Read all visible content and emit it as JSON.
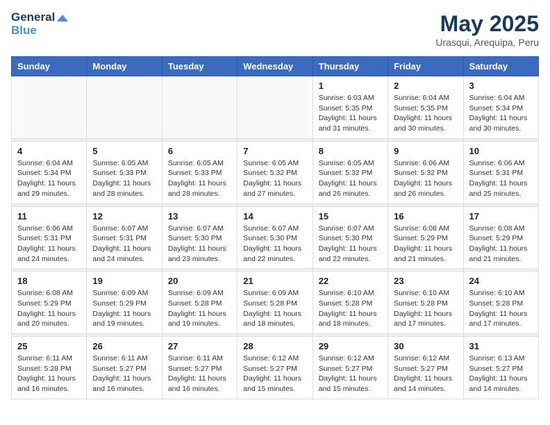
{
  "header": {
    "logo_line1": "General",
    "logo_line2": "Blue",
    "month": "May 2025",
    "location": "Urasqui, Arequipa, Peru"
  },
  "weekdays": [
    "Sunday",
    "Monday",
    "Tuesday",
    "Wednesday",
    "Thursday",
    "Friday",
    "Saturday"
  ],
  "weeks": [
    [
      {
        "day": "",
        "info": ""
      },
      {
        "day": "",
        "info": ""
      },
      {
        "day": "",
        "info": ""
      },
      {
        "day": "",
        "info": ""
      },
      {
        "day": "1",
        "info": "Sunrise: 6:03 AM\nSunset: 5:35 PM\nDaylight: 11 hours\nand 31 minutes."
      },
      {
        "day": "2",
        "info": "Sunrise: 6:04 AM\nSunset: 5:35 PM\nDaylight: 11 hours\nand 30 minutes."
      },
      {
        "day": "3",
        "info": "Sunrise: 6:04 AM\nSunset: 5:34 PM\nDaylight: 11 hours\nand 30 minutes."
      }
    ],
    [
      {
        "day": "4",
        "info": "Sunrise: 6:04 AM\nSunset: 5:34 PM\nDaylight: 11 hours\nand 29 minutes."
      },
      {
        "day": "5",
        "info": "Sunrise: 6:05 AM\nSunset: 5:33 PM\nDaylight: 11 hours\nand 28 minutes."
      },
      {
        "day": "6",
        "info": "Sunrise: 6:05 AM\nSunset: 5:33 PM\nDaylight: 11 hours\nand 28 minutes."
      },
      {
        "day": "7",
        "info": "Sunrise: 6:05 AM\nSunset: 5:32 PM\nDaylight: 11 hours\nand 27 minutes."
      },
      {
        "day": "8",
        "info": "Sunrise: 6:05 AM\nSunset: 5:32 PM\nDaylight: 11 hours\nand 26 minutes."
      },
      {
        "day": "9",
        "info": "Sunrise: 6:06 AM\nSunset: 5:32 PM\nDaylight: 11 hours\nand 26 minutes."
      },
      {
        "day": "10",
        "info": "Sunrise: 6:06 AM\nSunset: 5:31 PM\nDaylight: 11 hours\nand 25 minutes."
      }
    ],
    [
      {
        "day": "11",
        "info": "Sunrise: 6:06 AM\nSunset: 5:31 PM\nDaylight: 11 hours\nand 24 minutes."
      },
      {
        "day": "12",
        "info": "Sunrise: 6:07 AM\nSunset: 5:31 PM\nDaylight: 11 hours\nand 24 minutes."
      },
      {
        "day": "13",
        "info": "Sunrise: 6:07 AM\nSunset: 5:30 PM\nDaylight: 11 hours\nand 23 minutes."
      },
      {
        "day": "14",
        "info": "Sunrise: 6:07 AM\nSunset: 5:30 PM\nDaylight: 11 hours\nand 22 minutes."
      },
      {
        "day": "15",
        "info": "Sunrise: 6:07 AM\nSunset: 5:30 PM\nDaylight: 11 hours\nand 22 minutes."
      },
      {
        "day": "16",
        "info": "Sunrise: 6:08 AM\nSunset: 5:29 PM\nDaylight: 11 hours\nand 21 minutes."
      },
      {
        "day": "17",
        "info": "Sunrise: 6:08 AM\nSunset: 5:29 PM\nDaylight: 11 hours\nand 21 minutes."
      }
    ],
    [
      {
        "day": "18",
        "info": "Sunrise: 6:08 AM\nSunset: 5:29 PM\nDaylight: 11 hours\nand 20 minutes."
      },
      {
        "day": "19",
        "info": "Sunrise: 6:09 AM\nSunset: 5:29 PM\nDaylight: 11 hours\nand 19 minutes."
      },
      {
        "day": "20",
        "info": "Sunrise: 6:09 AM\nSunset: 5:28 PM\nDaylight: 11 hours\nand 19 minutes."
      },
      {
        "day": "21",
        "info": "Sunrise: 6:09 AM\nSunset: 5:28 PM\nDaylight: 11 hours\nand 18 minutes."
      },
      {
        "day": "22",
        "info": "Sunrise: 6:10 AM\nSunset: 5:28 PM\nDaylight: 11 hours\nand 18 minutes."
      },
      {
        "day": "23",
        "info": "Sunrise: 6:10 AM\nSunset: 5:28 PM\nDaylight: 11 hours\nand 17 minutes."
      },
      {
        "day": "24",
        "info": "Sunrise: 6:10 AM\nSunset: 5:28 PM\nDaylight: 11 hours\nand 17 minutes."
      }
    ],
    [
      {
        "day": "25",
        "info": "Sunrise: 6:11 AM\nSunset: 5:28 PM\nDaylight: 11 hours\nand 16 minutes."
      },
      {
        "day": "26",
        "info": "Sunrise: 6:11 AM\nSunset: 5:27 PM\nDaylight: 11 hours\nand 16 minutes."
      },
      {
        "day": "27",
        "info": "Sunrise: 6:11 AM\nSunset: 5:27 PM\nDaylight: 11 hours\nand 16 minutes."
      },
      {
        "day": "28",
        "info": "Sunrise: 6:12 AM\nSunset: 5:27 PM\nDaylight: 11 hours\nand 15 minutes."
      },
      {
        "day": "29",
        "info": "Sunrise: 6:12 AM\nSunset: 5:27 PM\nDaylight: 11 hours\nand 15 minutes."
      },
      {
        "day": "30",
        "info": "Sunrise: 6:12 AM\nSunset: 5:27 PM\nDaylight: 11 hours\nand 14 minutes."
      },
      {
        "day": "31",
        "info": "Sunrise: 6:13 AM\nSunset: 5:27 PM\nDaylight: 11 hours\nand 14 minutes."
      }
    ]
  ]
}
